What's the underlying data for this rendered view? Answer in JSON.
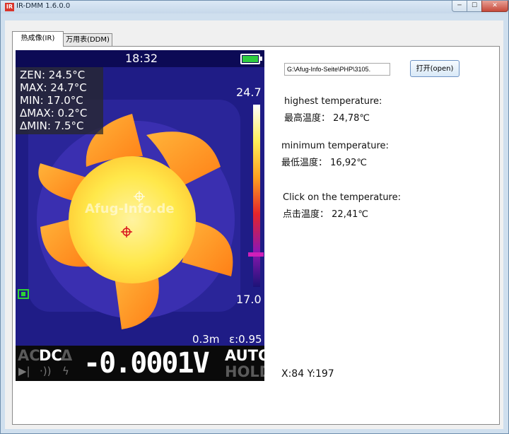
{
  "window": {
    "title": "IR-DMM 1.6.0.0",
    "icon_letter": "IR",
    "controls": {
      "minimize": "─",
      "maximize": "☐",
      "close": "✕"
    }
  },
  "tabs": [
    {
      "label": "热成像(IR)",
      "active": true
    },
    {
      "label": "万用表(DDM)",
      "active": false
    }
  ],
  "ir_screen": {
    "time": "18:32",
    "stats": [
      "ZEN: 24.5°C",
      "MAX: 24.7°C",
      "MIN: 17.0°C",
      "ΔMAX:  0.2°C",
      "ΔMIN:  7.5°C"
    ],
    "scale_max": "24.7",
    "scale_min": "17.0",
    "watermark": "Afug-Info.de",
    "distance": "0.3m",
    "emissivity": "ε:0.95",
    "dmm": {
      "ac": "AC",
      "dc": "DC",
      "delta": "Δ",
      "value": "-0.0001V",
      "auto": "AUTO",
      "hold": "HOLD"
    }
  },
  "file": {
    "path": "G:\\Afug-Info-Seite\\PHP\\3105.",
    "open_button": "打开(open)"
  },
  "readings": {
    "highest_label_en": "highest temperature:",
    "highest_label_cn": "最高温度：",
    "highest_value": "24,78℃",
    "minimum_label_en": "minimum temperature:",
    "minimum_label_cn": "最低温度：",
    "minimum_value": "16,92℃",
    "click_label_en": "Click on the  temperature:",
    "click_label_cn": "点击温度：",
    "click_value": "22,41℃"
  },
  "cursor_readout": "X:84 Y:197",
  "colors": {
    "ir_background": "#1f1c86",
    "fan_hot": "#ffe84a",
    "fan_warm": "#ff9a1c",
    "titlebar": "#c6d8ea"
  }
}
